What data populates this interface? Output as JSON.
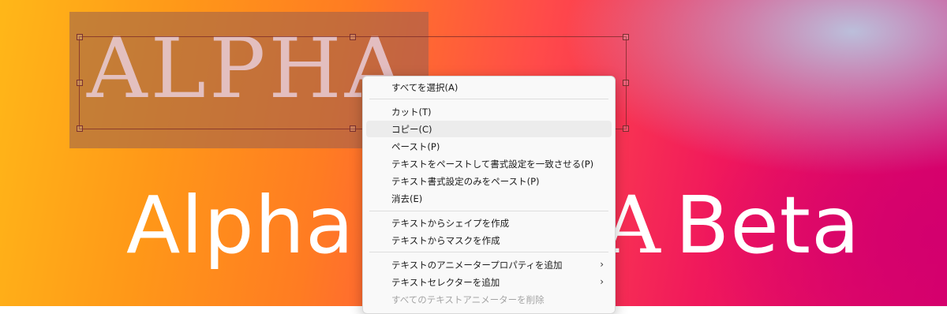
{
  "canvas": {
    "selected_text": "ALPHA",
    "headline_part1": "Alpha",
    "headline_part2": "ALPHA",
    "headline_part3": "Beta"
  },
  "context_menu": {
    "select_all": "すべてを選択(A)",
    "cut": "カット(T)",
    "copy": "コピー(C)",
    "paste": "ペースト(P)",
    "paste_match_format": "テキストをペーストして書式設定を一致させる(P)",
    "paste_format_only": "テキスト書式設定のみをペースト(P)",
    "delete": "消去(E)",
    "shape_from_text": "テキストからシェイプを作成",
    "mask_from_text": "テキストからマスクを作成",
    "add_animator_property": "テキストのアニメータープロパティを追加",
    "add_selector": "テキストセレクターを追加",
    "remove_all_animators": "すべてのテキストアニメーターを削除",
    "submenu_arrow": "›",
    "hovered_item": "copy"
  },
  "colors": {
    "menu_background": "#f9f9f9",
    "hover_background": "#ececec",
    "disabled_text": "#a4a4a4"
  }
}
